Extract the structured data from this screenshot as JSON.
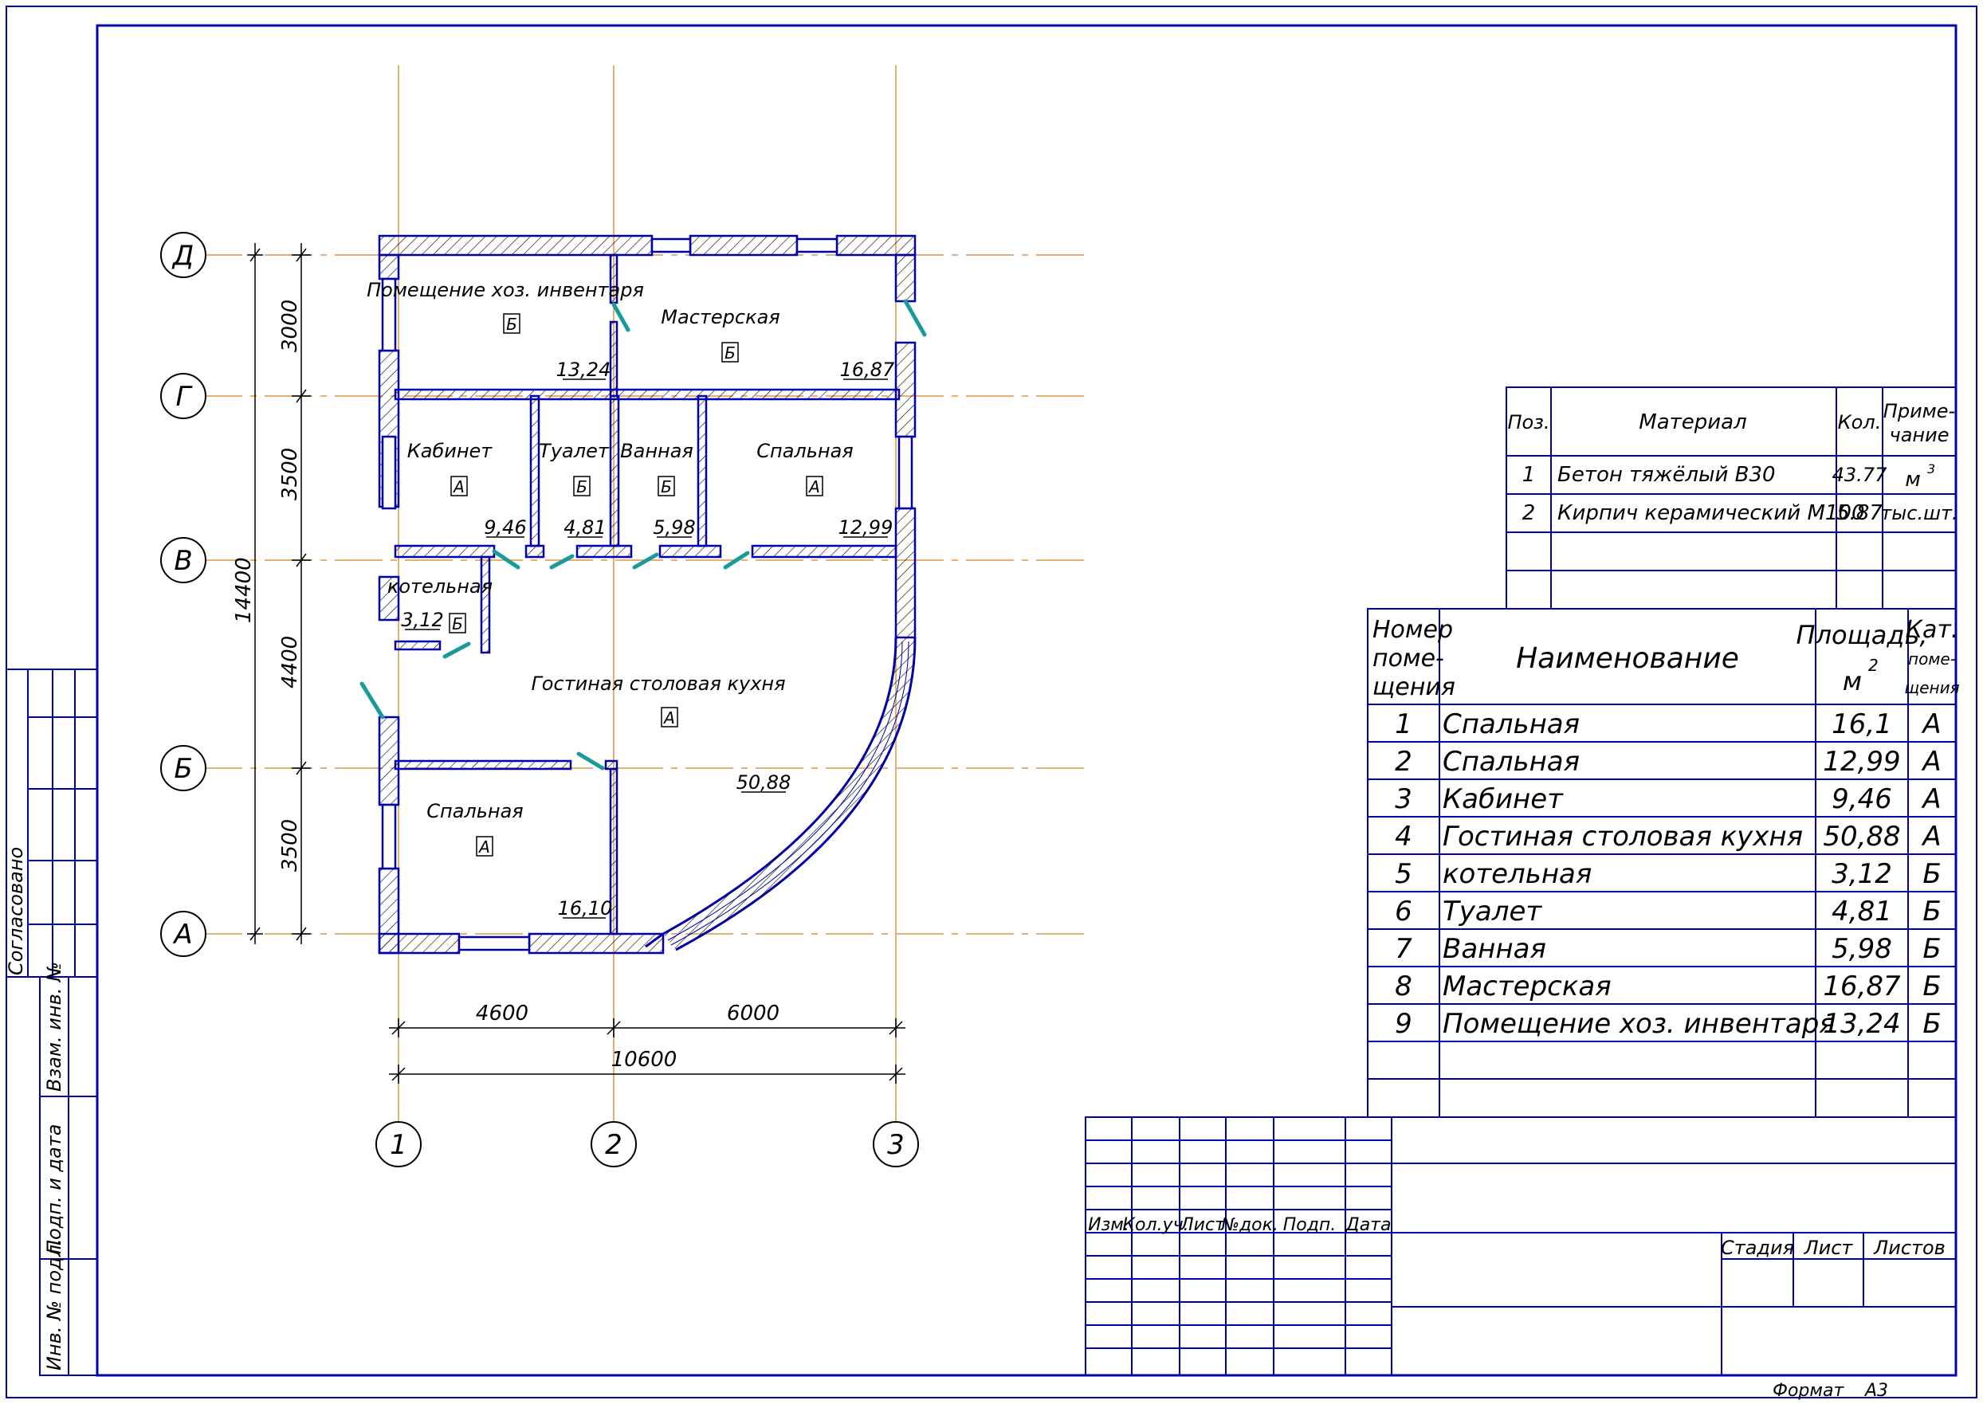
{
  "format": {
    "label": "Формат",
    "value": "А3"
  },
  "side_stamp": {
    "agreed": "Согласовано",
    "replacement_inv": "Взам. инв. №",
    "signature_date": "Подп. и дата",
    "original_inv": "Инв. № подл."
  },
  "title_block": {
    "headers": [
      "Изм.",
      "Кол.уч.",
      "Лист",
      "№док.",
      "Подп.",
      "Дата"
    ],
    "stage_headers": [
      "Стадия",
      "Лист",
      "Листов"
    ]
  },
  "axes": {
    "rows": [
      {
        "label": "Д"
      },
      {
        "label": "Г"
      },
      {
        "label": "В"
      },
      {
        "label": "Б"
      },
      {
        "label": "А"
      }
    ],
    "columns": [
      {
        "label": "1"
      },
      {
        "label": "2"
      },
      {
        "label": "3"
      }
    ]
  },
  "dimensions": {
    "vertical": [
      "3000",
      "3500",
      "4400",
      "3500"
    ],
    "vertical_total": "14400",
    "horizontal": [
      "4600",
      "6000"
    ],
    "horizontal_total": "10600"
  },
  "rooms": [
    {
      "name": "Помещение хоз. инвентаря",
      "cat": "Б",
      "area": "13,24"
    },
    {
      "name": "Мастерская",
      "cat": "Б",
      "area": "16,87"
    },
    {
      "name": "Кабинет",
      "cat": "А",
      "area": "9,46"
    },
    {
      "name": "Туалет",
      "cat": "Б",
      "area": "4,81"
    },
    {
      "name": "Ванная",
      "cat": "Б",
      "area": "5,98"
    },
    {
      "name": "Спальная",
      "cat": "А",
      "area": "12,99"
    },
    {
      "name": "котельная",
      "cat": "Б",
      "area": "3,12"
    },
    {
      "name": "Гостиная столовая кухня",
      "cat": "А",
      "area": "50,88"
    },
    {
      "name": "Спальная",
      "cat": "А",
      "area": "16,10"
    }
  ],
  "materials_table": {
    "headers": {
      "pos": "Поз.",
      "material": "Материал",
      "qty": "Кол.",
      "note_1": "Приме-",
      "note_2": "чание"
    },
    "rows": [
      {
        "pos": "1",
        "material": "Бетон тяжёлый В30",
        "qty": "43.77",
        "unit": "м",
        "unit_sup": "3"
      },
      {
        "pos": "2",
        "material": "Кирпич керамический М100",
        "qty": "5.87",
        "unit": "тыс.шт.",
        "unit_sup": ""
      }
    ]
  },
  "rooms_table": {
    "headers": {
      "num": [
        "Номер",
        "поме-",
        "щения"
      ],
      "name": "Наименование",
      "area": "Площадь,",
      "area_unit": "м",
      "area_sup": "2",
      "cat": [
        "Кат.",
        "поме-",
        "щения"
      ]
    },
    "rows": [
      {
        "num": "1",
        "name": "Спальная",
        "area": "16,1",
        "cat": "А"
      },
      {
        "num": "2",
        "name": "Спальная",
        "area": "12,99",
        "cat": "А"
      },
      {
        "num": "3",
        "name": "Кабинет",
        "area": "9,46",
        "cat": "А"
      },
      {
        "num": "4",
        "name": "Гостиная столовая кухня",
        "area": "50,88",
        "cat": "А"
      },
      {
        "num": "5",
        "name": "котельная",
        "area": "3,12",
        "cat": "Б"
      },
      {
        "num": "6",
        "name": "Туалет",
        "area": "4,81",
        "cat": "Б"
      },
      {
        "num": "7",
        "name": "Ванная",
        "area": "5,98",
        "cat": "Б"
      },
      {
        "num": "8",
        "name": "Мастерская",
        "area": "16,87",
        "cat": "Б"
      },
      {
        "num": "9",
        "name": "Помещение хоз. инвентаря",
        "area": "13,24",
        "cat": "Б"
      }
    ]
  },
  "colors": {
    "frame": "#0000aa",
    "axis": "#e8b070",
    "door": "#1a9a9a",
    "hatch": "#000000"
  }
}
